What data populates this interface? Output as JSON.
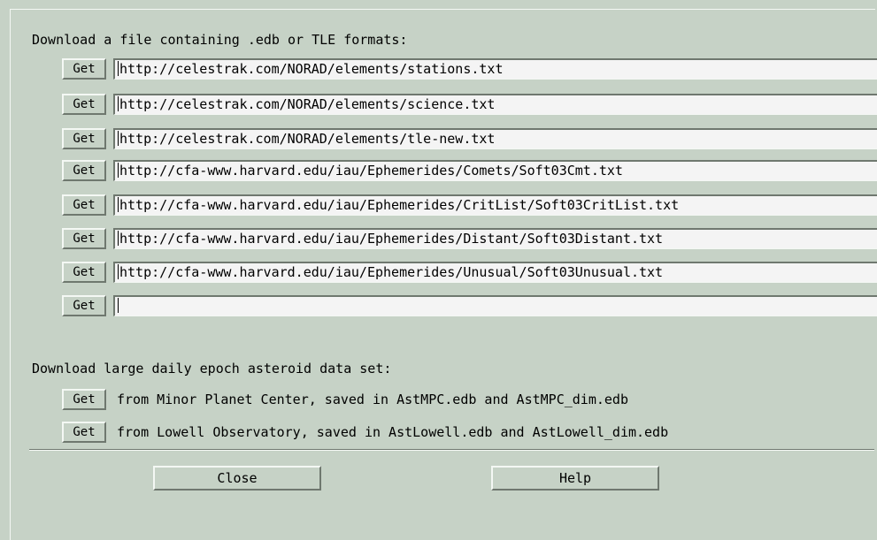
{
  "download": {
    "heading": "Download a file containing .edb or TLE formats:",
    "get_label": "Get",
    "urls": [
      "http://celestrak.com/NORAD/elements/stations.txt",
      "http://celestrak.com/NORAD/elements/science.txt",
      "http://celestrak.com/NORAD/elements/tle-new.txt",
      "http://cfa-www.harvard.edu/iau/Ephemerides/Comets/Soft03Cmt.txt",
      "http://cfa-www.harvard.edu/iau/Ephemerides/CritList/Soft03CritList.txt",
      "http://cfa-www.harvard.edu/iau/Ephemerides/Distant/Soft03Distant.txt",
      "http://cfa-www.harvard.edu/iau/Ephemerides/Unusual/Soft03Unusual.txt",
      ""
    ]
  },
  "epoch": {
    "heading": "Download large daily epoch asteroid data set:",
    "get_label": "Get",
    "sources": [
      "from Minor Planet Center, saved in AstMPC.edb and AstMPC_dim.edb",
      "from Lowell Observatory, saved in AstLowell.edb and AstLowell_dim.edb"
    ]
  },
  "buttons": {
    "close": "Close",
    "help": "Help"
  }
}
